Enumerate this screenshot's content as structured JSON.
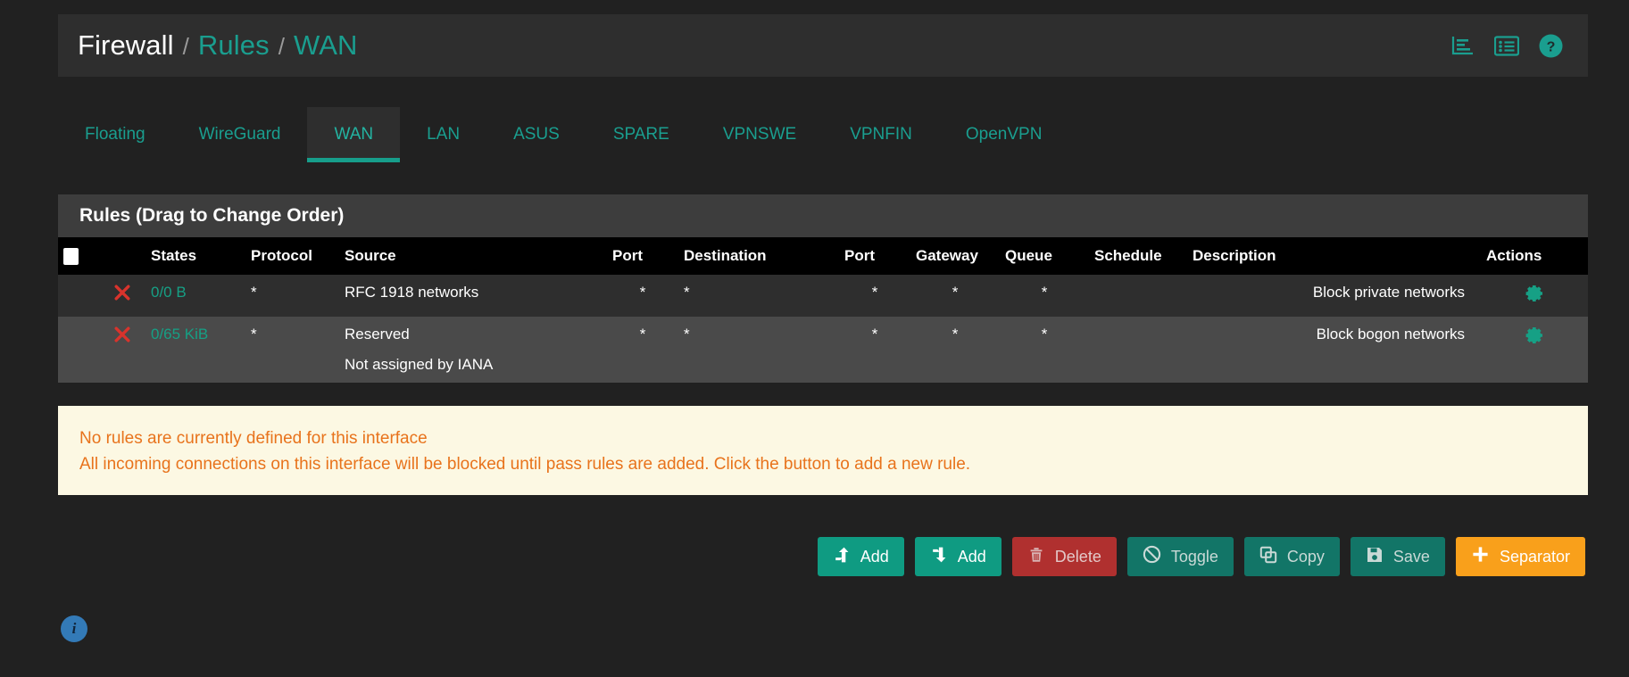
{
  "header": {
    "breadcrumb": {
      "root": "Firewall",
      "separator": "/",
      "section": "Rules",
      "current": "WAN"
    },
    "icons": [
      {
        "name": "statistics-icon",
        "title": "Statistics"
      },
      {
        "name": "rule-list-icon",
        "title": "Rule List"
      },
      {
        "name": "help-icon",
        "title": "Help"
      }
    ]
  },
  "tabs": [
    {
      "label": "Floating",
      "active": false
    },
    {
      "label": "WireGuard",
      "active": false
    },
    {
      "label": "WAN",
      "active": true
    },
    {
      "label": "LAN",
      "active": false
    },
    {
      "label": "ASUS",
      "active": false
    },
    {
      "label": "SPARE",
      "active": false
    },
    {
      "label": "VPNSWE",
      "active": false
    },
    {
      "label": "VPNFIN",
      "active": false
    },
    {
      "label": "OpenVPN",
      "active": false
    }
  ],
  "panel": {
    "title": "Rules (Drag to Change Order)",
    "columns": {
      "checkbox": "",
      "action": "",
      "states": "States",
      "protocol": "Protocol",
      "source": "Source",
      "port_src": "Port",
      "destination": "Destination",
      "port_dst": "Port",
      "gateway": "Gateway",
      "queue": "Queue",
      "schedule": "Schedule",
      "description": "Description",
      "actions": "Actions"
    },
    "rows": [
      {
        "action_icon": "block-x-icon",
        "states": "0/0 B",
        "protocol": "*",
        "source": "RFC 1918 networks",
        "source_line2": "",
        "port_src": "*",
        "destination": "*",
        "port_dst": "*",
        "gateway": "*",
        "queue": "*",
        "schedule": "",
        "description": "Block private networks",
        "actions_icon": "gear-icon"
      },
      {
        "action_icon": "block-x-icon",
        "states": "0/65 KiB",
        "protocol": "*",
        "source": "Reserved",
        "source_line2": "Not assigned by IANA",
        "port_src": "*",
        "destination": "*",
        "port_dst": "*",
        "gateway": "*",
        "queue": "*",
        "schedule": "",
        "description": "Block bogon networks",
        "actions_icon": "gear-icon"
      }
    ]
  },
  "warning": {
    "line1": "No rules are currently defined for this interface",
    "line2": "All incoming connections on this interface will be blocked until pass rules are added. Click the button to add a new rule."
  },
  "buttons": [
    {
      "label": "Add",
      "icon": "arrow-up-icon",
      "style": "teal"
    },
    {
      "label": "Add",
      "icon": "arrow-down-icon",
      "style": "teal"
    },
    {
      "label": "Delete",
      "icon": "trash-icon",
      "style": "red"
    },
    {
      "label": "Toggle",
      "icon": "ban-icon",
      "style": "dteal"
    },
    {
      "label": "Copy",
      "icon": "clone-icon",
      "style": "dteal"
    },
    {
      "label": "Save",
      "icon": "save-icon",
      "style": "dteal"
    },
    {
      "label": "Separator",
      "icon": "plus-icon",
      "style": "orange"
    }
  ],
  "info_button": {
    "label": "i",
    "name": "info-icon"
  },
  "colors": {
    "page_bg": "#212121",
    "panel_bg": "#2e2e2e",
    "row_alt_bg": "#4a4a4a",
    "accent_teal": "#1a9e8f",
    "states_teal": "#16a085",
    "block_red": "#d9332c",
    "warning_bg": "#fcf8e3",
    "warning_text": "#e8731c",
    "orange_btn": "#f9a01b",
    "red_btn": "#b0302f",
    "info_blue": "#337ab7"
  }
}
